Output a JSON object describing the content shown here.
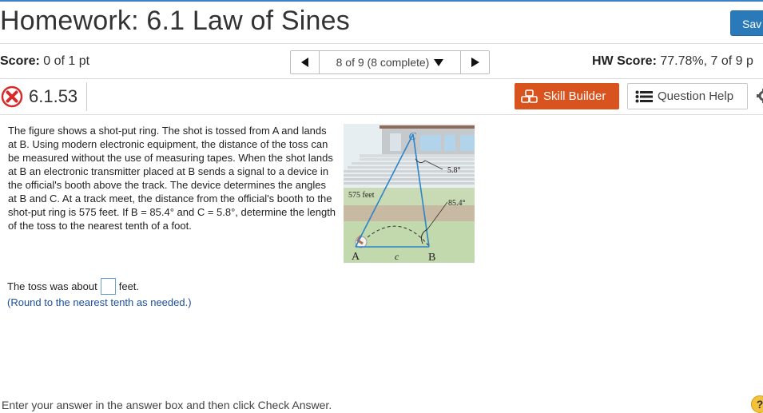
{
  "header": {
    "title": "Homework: 6.1 Law of Sines",
    "save_label": "Sav"
  },
  "score_bar": {
    "score_label": "Score:",
    "score_value": "0 of 1 pt",
    "nav_text": "8 of 9 (8 complete)",
    "hw_score_label": "HW Score:",
    "hw_score_value": "77.78%, 7 of 9 p"
  },
  "question": {
    "number": "6.1.53",
    "skill_builder_label": "Skill Builder",
    "question_help_label": "Question Help",
    "problem_text": "The figure shows a shot-put ring. The shot is tossed from A and lands at B. Using modern electronic equipment, the distance of the toss can be measured without the use of measuring tapes. When the shot lands at B an electronic transmitter placed at B sends a signal to a device in the official's booth above the track. The device determines the angles at B and C. At a track meet, the distance from the official's booth to the shot-put ring is 575 feet. If B = 85.4° and C = 5.8°, determine the length of the toss to the nearest tenth of a foot.",
    "answer_prefix": "The toss was about",
    "answer_suffix": "feet.",
    "answer_value": "",
    "round_note": "(Round to the nearest tenth as needed.)"
  },
  "figure": {
    "label_C": "C",
    "label_A": "A",
    "label_B": "B",
    "label_c": "c",
    "side_label": "575 feet",
    "angle_C": "5.8°",
    "angle_B": "85.4°"
  },
  "footer": {
    "instruction": "Enter your answer in the answer box and then click Check Answer.",
    "help_icon_text": "?"
  },
  "colors": {
    "accent": "#2a7ab9",
    "skill_builder": "#d9531e",
    "incorrect": "#d62b2b",
    "note": "#1b4f9c"
  }
}
